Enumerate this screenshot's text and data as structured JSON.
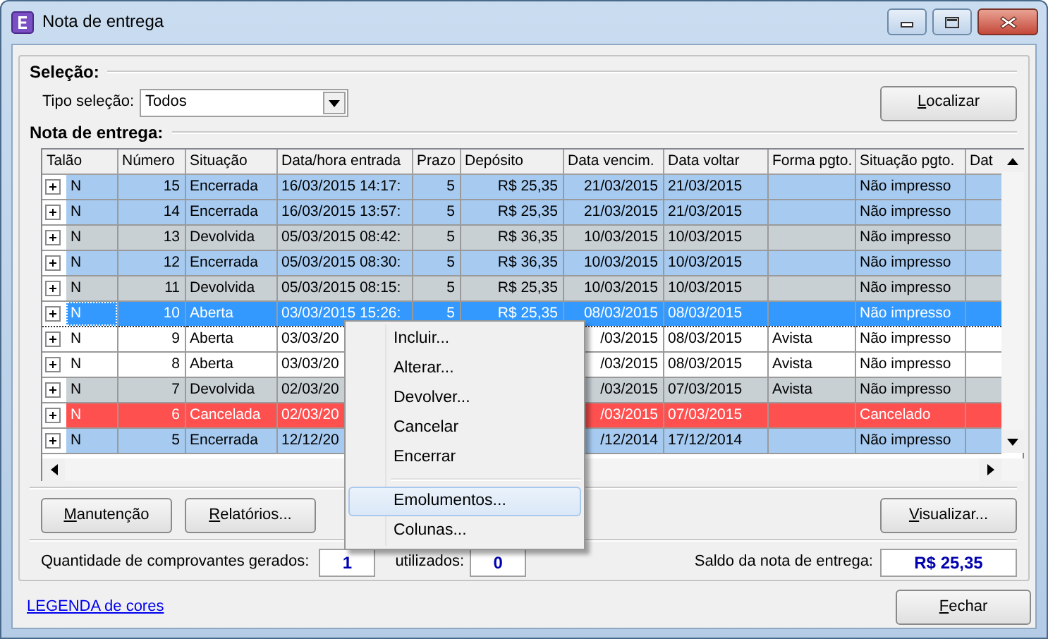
{
  "window": {
    "title": "Nota de entrega"
  },
  "selecao": {
    "heading": "Seleção:",
    "label": "Tipo seleção:",
    "value": "Todos",
    "button": {
      "label": "Localizar",
      "underline_first": true
    }
  },
  "grid": {
    "heading": "Nota de entrega:",
    "columns": [
      "Talão",
      "Número",
      "Situação",
      "Data/hora entrada",
      "Prazo",
      "Depósito",
      "Data vencim.",
      "Data voltar",
      "Forma pgto.",
      "Situação pgto.",
      "Dat"
    ],
    "rows": [
      {
        "talao": "N",
        "numero": "15",
        "situacao": "Encerrada",
        "data_entrada": "16/03/2015 14:17:",
        "prazo": "5",
        "deposito": "R$ 25,35",
        "data_vencim": "21/03/2015",
        "data_voltar": "21/03/2015",
        "situacao_pgto": "Não impresso",
        "color": "#a6caf0",
        "selected": false
      },
      {
        "talao": "N",
        "numero": "14",
        "situacao": "Encerrada",
        "data_entrada": "16/03/2015 13:57:",
        "prazo": "5",
        "deposito": "R$ 25,35",
        "data_vencim": "21/03/2015",
        "data_voltar": "21/03/2015",
        "situacao_pgto": "Não impresso",
        "color": "#a6caf0",
        "selected": false
      },
      {
        "talao": "N",
        "numero": "13",
        "situacao": "Devolvida",
        "data_entrada": "05/03/2015 08:42:",
        "prazo": "5",
        "deposito": "R$ 36,35",
        "data_vencim": "10/03/2015",
        "data_voltar": "10/03/2015",
        "situacao_pgto": "Não impresso",
        "color": "#c8d0d4",
        "selected": false
      },
      {
        "talao": "N",
        "numero": "12",
        "situacao": "Encerrada",
        "data_entrada": "05/03/2015 08:30:",
        "prazo": "5",
        "deposito": "R$ 36,35",
        "data_vencim": "10/03/2015",
        "data_voltar": "10/03/2015",
        "situacao_pgto": "Não impresso",
        "color": "#a6caf0",
        "selected": false
      },
      {
        "talao": "N",
        "numero": "11",
        "situacao": "Devolvida",
        "data_entrada": "05/03/2015 08:15:",
        "prazo": "5",
        "deposito": "R$ 25,35",
        "data_vencim": "10/03/2015",
        "data_voltar": "10/03/2015",
        "situacao_pgto": "Não impresso",
        "color": "#c8d0d4",
        "selected": false
      },
      {
        "talao": "N",
        "numero": "10",
        "situacao": "Aberta",
        "data_entrada": "03/03/2015 15:26:",
        "prazo": "5",
        "deposito": "R$ 25,35",
        "data_vencim": "08/03/2015",
        "data_voltar": "08/03/2015",
        "situacao_pgto": "Não impresso",
        "color": "#3399ff",
        "selected": true
      },
      {
        "talao": "N",
        "numero": "9",
        "situacao": "Aberta",
        "data_entrada": "03/03/20",
        "data_vencim": "/03/2015",
        "data_voltar": "08/03/2015",
        "forma_pgto": "Avista",
        "situacao_pgto": "Não impresso",
        "color": "#ffffff",
        "selected": false
      },
      {
        "talao": "N",
        "numero": "8",
        "situacao": "Aberta",
        "data_entrada": "03/03/20",
        "data_vencim": "/03/2015",
        "data_voltar": "08/03/2015",
        "forma_pgto": "Avista",
        "situacao_pgto": "Não impresso",
        "color": "#ffffff",
        "selected": false
      },
      {
        "talao": "N",
        "numero": "7",
        "situacao": "Devolvida",
        "data_entrada": "02/03/20",
        "data_vencim": "/03/2015",
        "data_voltar": "07/03/2015",
        "forma_pgto": "Avista",
        "situacao_pgto": "Não impresso",
        "color": "#c8d0d4",
        "selected": false
      },
      {
        "talao": "N",
        "numero": "6",
        "situacao": "Cancelada",
        "data_entrada": "02/03/20",
        "data_vencim": "/03/2015",
        "data_voltar": "07/03/2015",
        "situacao_pgto": "Cancelado",
        "color": "#ff5050",
        "selected": false
      },
      {
        "talao": "N",
        "numero": "5",
        "situacao": "Encerrada",
        "data_entrada": "12/12/20",
        "data_vencim": "/12/2014",
        "data_voltar": "17/12/2014",
        "situacao_pgto": "Não impresso",
        "color": "#a6caf0",
        "selected": false
      }
    ]
  },
  "context_menu": [
    {
      "kind": "item",
      "label": "Incluir...",
      "hovered": false
    },
    {
      "kind": "item",
      "label": "Alterar...",
      "hovered": false
    },
    {
      "kind": "item",
      "label": "Devolver...",
      "hovered": false
    },
    {
      "kind": "item",
      "label": "Cancelar",
      "hovered": false
    },
    {
      "kind": "item",
      "label": "Encerrar",
      "hovered": false
    },
    {
      "kind": "separator"
    },
    {
      "kind": "item",
      "label": "Emolumentos...",
      "hovered": true
    },
    {
      "kind": "item",
      "label": "Colunas...",
      "hovered": false
    }
  ],
  "actions": {
    "left": [
      {
        "label": "Manutenção",
        "underline_first": true
      },
      {
        "label": "Relatórios...",
        "underline_first": true
      }
    ],
    "right": [
      {
        "label": "Visualizar...",
        "underline_first": true
      }
    ]
  },
  "counters": {
    "gerados_label": "Quantidade de comprovantes gerados:",
    "gerados": "1",
    "utilizados_label": "utilizados:",
    "utilizados": "0",
    "saldo_label": "Saldo da nota de entrega:",
    "saldo": "R$ 25,35"
  },
  "footer": {
    "link": "LEGENDA de cores",
    "button": {
      "label": "Fechar",
      "underline_first": true
    }
  }
}
